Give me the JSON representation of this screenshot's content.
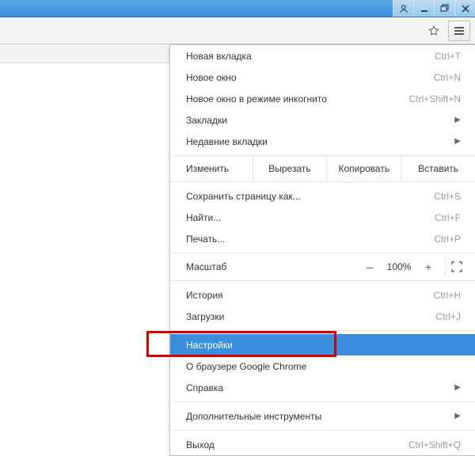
{
  "titlebar": {
    "buttons": [
      "user",
      "minimize",
      "restore",
      "close"
    ]
  },
  "toolbar": {
    "star_icon": "star-icon",
    "menu_icon": "hamburger-icon"
  },
  "menu": {
    "new_tab": {
      "label": "Новая вкладка",
      "shortcut": "Ctrl+T"
    },
    "new_window": {
      "label": "Новое окно",
      "shortcut": "Ctrl+N"
    },
    "incognito": {
      "label": "Новое окно в режиме инкогнито",
      "shortcut": "Ctrl+Shift+N"
    },
    "bookmarks": {
      "label": "Закладки"
    },
    "recent_tabs": {
      "label": "Недавние вкладки"
    },
    "edit": {
      "title": "Изменить",
      "cut": "Вырезать",
      "copy": "Копировать",
      "paste": "Вставить"
    },
    "save_as": {
      "label": "Сохранить страницу как...",
      "shortcut": "Ctrl+S"
    },
    "find": {
      "label": "Найти...",
      "shortcut": "Ctrl+F"
    },
    "print": {
      "label": "Печать...",
      "shortcut": "Ctrl+P"
    },
    "zoom": {
      "label": "Масштаб",
      "minus": "–",
      "value": "100%",
      "plus": "+"
    },
    "history": {
      "label": "История",
      "shortcut": "Ctrl+H"
    },
    "downloads": {
      "label": "Загрузки",
      "shortcut": "Ctrl+J"
    },
    "settings": {
      "label": "Настройки"
    },
    "about": {
      "label": "О браузере Google Chrome"
    },
    "help": {
      "label": "Справка"
    },
    "more_tools": {
      "label": "Дополнительные инструменты"
    },
    "exit": {
      "label": "Выход",
      "shortcut": "Ctrl+Shift+Q"
    }
  }
}
